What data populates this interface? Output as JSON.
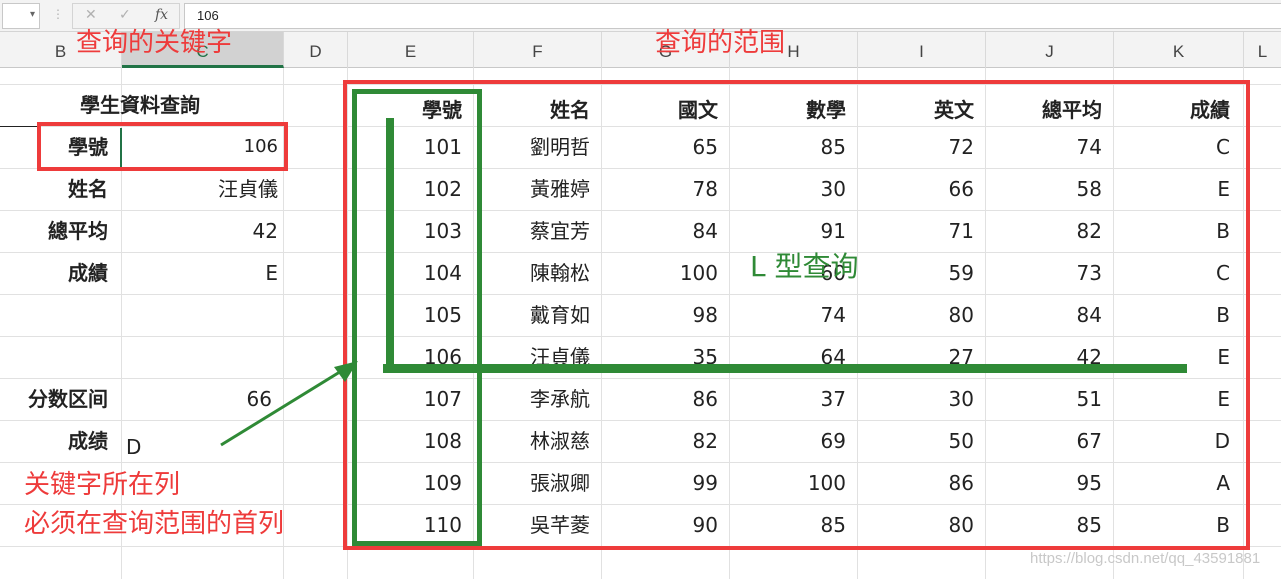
{
  "formula_bar": {
    "name_box": "",
    "formula": "106",
    "fx_label": "fx"
  },
  "columns": [
    "B",
    "C",
    "D",
    "E",
    "F",
    "G",
    "H",
    "I",
    "J",
    "K",
    "L"
  ],
  "lookup_panel": {
    "title": "學生資料查詢",
    "rows": [
      {
        "label": "學號",
        "value": "106"
      },
      {
        "label": "姓名",
        "value": "汪貞儀"
      },
      {
        "label": "總平均",
        "value": "42"
      },
      {
        "label": "成績",
        "value": "E"
      }
    ],
    "score_range_label": "分数区间",
    "score_range_value": "66",
    "grade_label": "成绩",
    "grade_value": "D"
  },
  "table": {
    "headers": [
      "學號",
      "姓名",
      "國文",
      "數學",
      "英文",
      "總平均",
      "成績"
    ],
    "rows": [
      [
        "101",
        "劉明哲",
        "65",
        "85",
        "72",
        "74",
        "C"
      ],
      [
        "102",
        "黃雅婷",
        "78",
        "30",
        "66",
        "58",
        "E"
      ],
      [
        "103",
        "蔡宜芳",
        "84",
        "91",
        "71",
        "82",
        "B"
      ],
      [
        "104",
        "陳翰松",
        "100",
        "60",
        "59",
        "73",
        "C"
      ],
      [
        "105",
        "戴育如",
        "98",
        "74",
        "80",
        "84",
        "B"
      ],
      [
        "106",
        "汪貞儀",
        "35",
        "64",
        "27",
        "42",
        "E"
      ],
      [
        "107",
        "李承航",
        "86",
        "37",
        "30",
        "51",
        "E"
      ],
      [
        "108",
        "林淑慈",
        "82",
        "69",
        "50",
        "67",
        "D"
      ],
      [
        "109",
        "張淑卿",
        "99",
        "100",
        "86",
        "95",
        "A"
      ],
      [
        "110",
        "吳芊菱",
        "90",
        "85",
        "80",
        "85",
        "B"
      ]
    ]
  },
  "annotations": {
    "keyword_label": "查询的关键字",
    "range_label": "查询的范围",
    "l_lookup_label": "L 型查询",
    "note_line1": "关键字所在列",
    "note_line2": "必须在查询范围的首列"
  },
  "watermark": "https://blog.csdn.net/qq_43591881",
  "colors": {
    "red": "#ee3b3b",
    "green": "#2f8a36"
  }
}
